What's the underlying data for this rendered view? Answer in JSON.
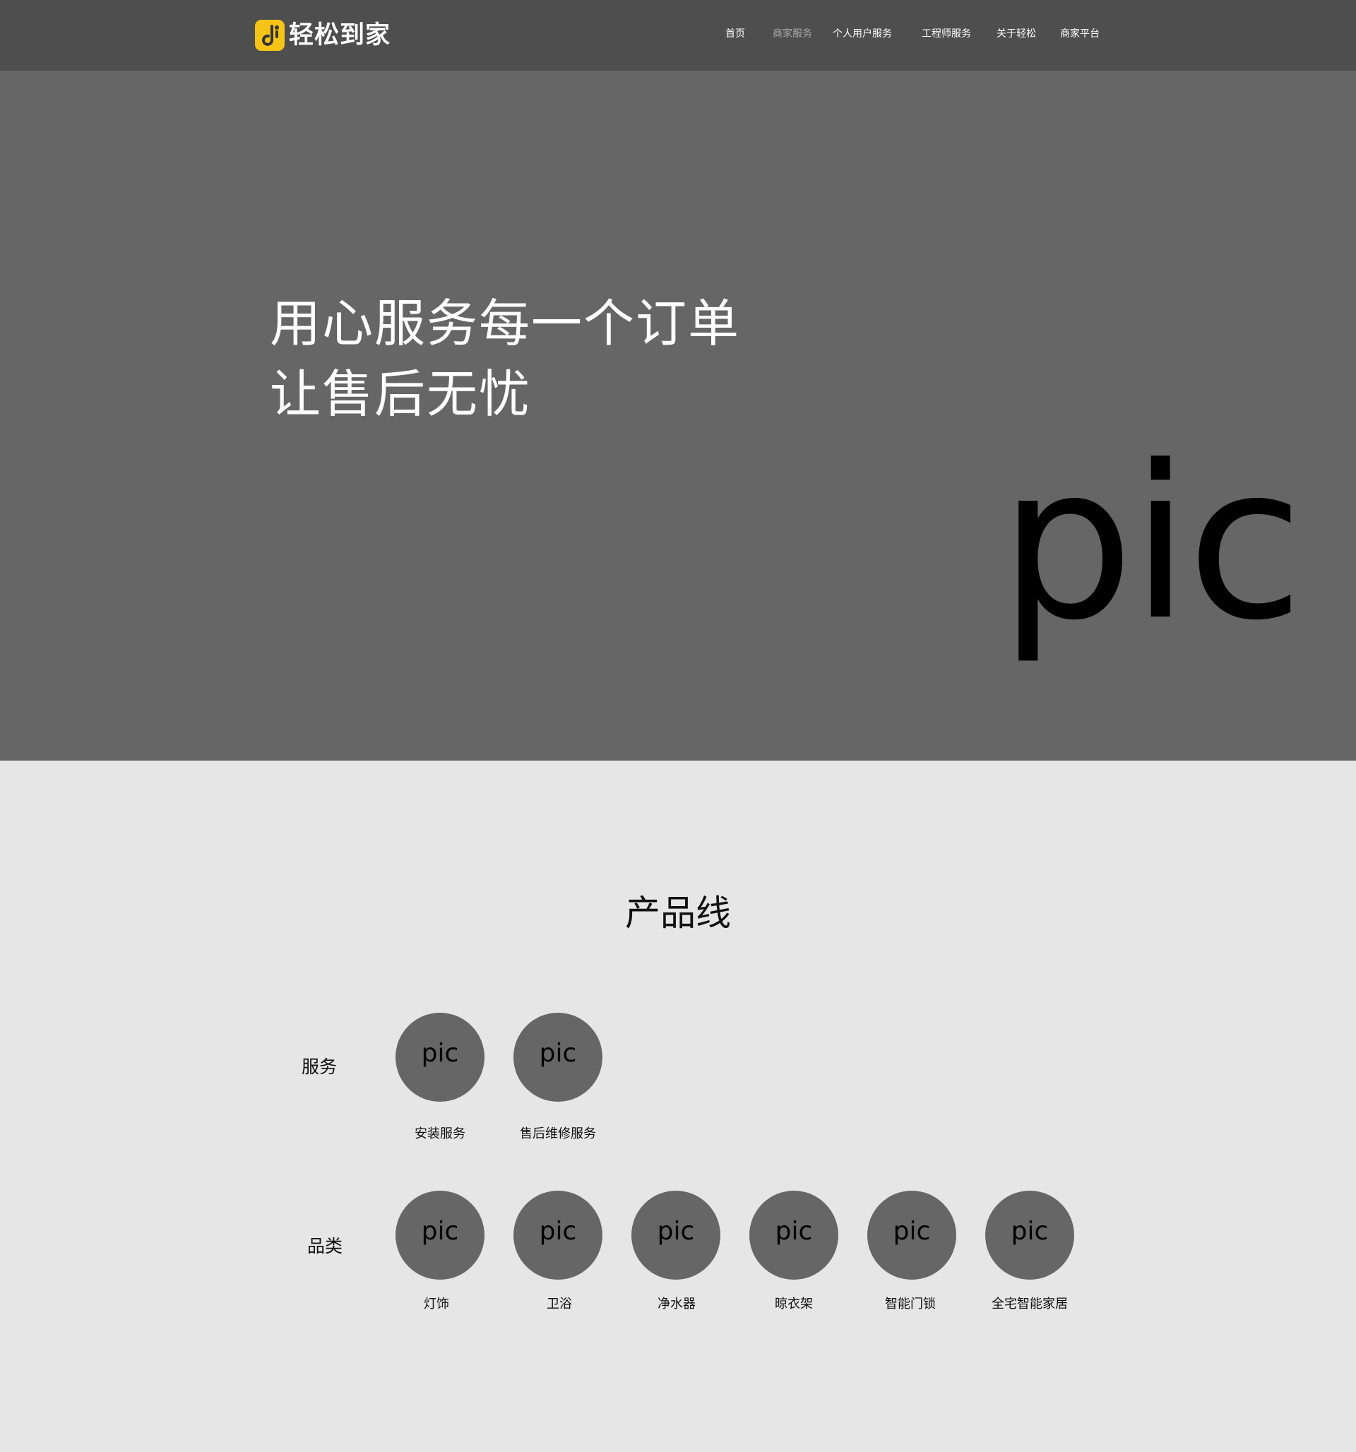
{
  "brand": {
    "name": "轻松到家",
    "accent_color": "#f6c417",
    "logo_icon": "music-note-logo-icon"
  },
  "nav": {
    "items": [
      {
        "label": "首页",
        "active": false
      },
      {
        "label": "商家服务",
        "active": true
      },
      {
        "label": "个人用户服务",
        "active": false
      },
      {
        "label": "工程师服务",
        "active": false
      },
      {
        "label": "关于轻松",
        "active": false
      },
      {
        "label": "商家平台",
        "active": false
      }
    ]
  },
  "hero": {
    "line1": "用心服务每一个订单",
    "line2": "让售后无忧",
    "pic": "pic",
    "background": "#666666"
  },
  "product_line": {
    "title": "产品线",
    "services": {
      "label": "服务",
      "items": [
        {
          "pic": "pic",
          "caption": "安装服务"
        },
        {
          "pic": "pic",
          "caption": "售后维修服务"
        }
      ]
    },
    "categories": {
      "label": "品类",
      "items": [
        {
          "pic": "pic",
          "caption": "灯饰"
        },
        {
          "pic": "pic",
          "caption": "卫浴"
        },
        {
          "pic": "pic",
          "caption": "净水器"
        },
        {
          "pic": "pic",
          "caption": "晾衣架"
        },
        {
          "pic": "pic",
          "caption": "智能门锁"
        },
        {
          "pic": "pic",
          "caption": "全宅智能家居"
        }
      ]
    }
  }
}
